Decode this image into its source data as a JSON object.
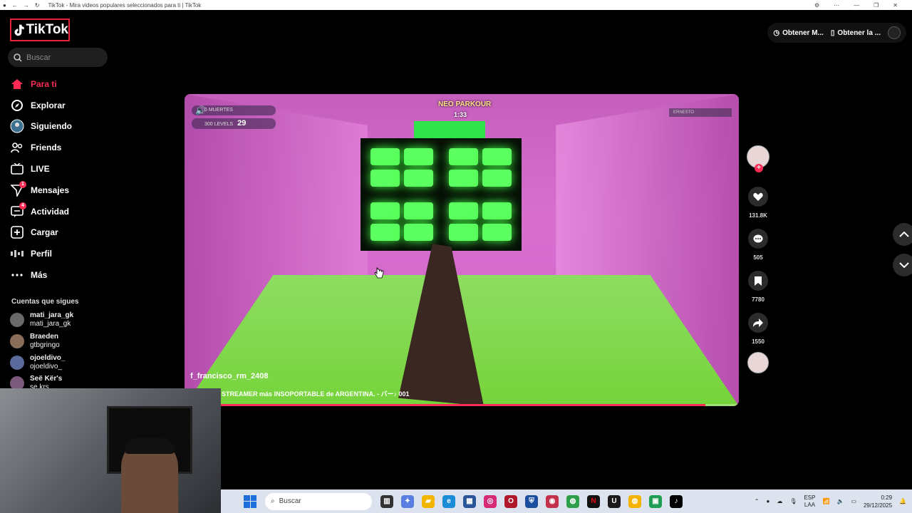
{
  "browser": {
    "title": "TikTok - Mira videos populares seleccionados para ti | TikTok"
  },
  "brand": {
    "name": "TikTok"
  },
  "search": {
    "placeholder": "Buscar"
  },
  "nav": [
    {
      "label": "Para ti",
      "icon": "home-icon",
      "active": true
    },
    {
      "label": "Explorar",
      "icon": "compass-icon"
    },
    {
      "label": "Siguiendo",
      "icon": "following-avatar-icon"
    },
    {
      "label": "Friends",
      "icon": "friends-icon"
    },
    {
      "label": "LIVE",
      "icon": "live-icon"
    },
    {
      "label": "Mensajes",
      "icon": "messages-icon",
      "badge": "1"
    },
    {
      "label": "Actividad",
      "icon": "activity-icon",
      "badge": "4"
    },
    {
      "label": "Cargar",
      "icon": "upload-icon"
    },
    {
      "label": "Perfil",
      "icon": "profile-icon"
    },
    {
      "label": "Más",
      "icon": "more-icon"
    }
  ],
  "following": {
    "title": "Cuentas que sigues",
    "accounts": [
      {
        "name": "mati_jara_gk",
        "username": "mati_jara_gk"
      },
      {
        "name": "Braeden",
        "username": "gtbgringo"
      },
      {
        "name": "ojoeldivo_",
        "username": "ojoeldivo_"
      },
      {
        "name": "Seë Kër's",
        "username": "se.krs"
      }
    ]
  },
  "top_buttons": {
    "get_app_1": "Obtener M...",
    "get_app_2": "Obtener la ..."
  },
  "video": {
    "author": "f_francisco_rm_2408",
    "caption": "STREAMER más INSOPORTABLE de ARGENTINA. - バー♪ 001",
    "game_title": "NEO PARKOUR",
    "game_timer": "1:33",
    "hud_levels_label": "300 LEVELS",
    "hud_levels_value": "29",
    "hud_deaths": "5 MUERTES",
    "hud_right": "ERNESTO",
    "progress_fraction": 0.94
  },
  "actions": {
    "likes": "131.8K",
    "comments": "505",
    "saves": "7780",
    "shares": "1550"
  },
  "taskbar": {
    "search_placeholder": "Buscar",
    "lang_1": "ESP",
    "lang_2": "LAA",
    "time": "0:29",
    "date": "29/12/2025"
  },
  "colors": {
    "accent": "#fe2c55",
    "background": "#000000"
  }
}
